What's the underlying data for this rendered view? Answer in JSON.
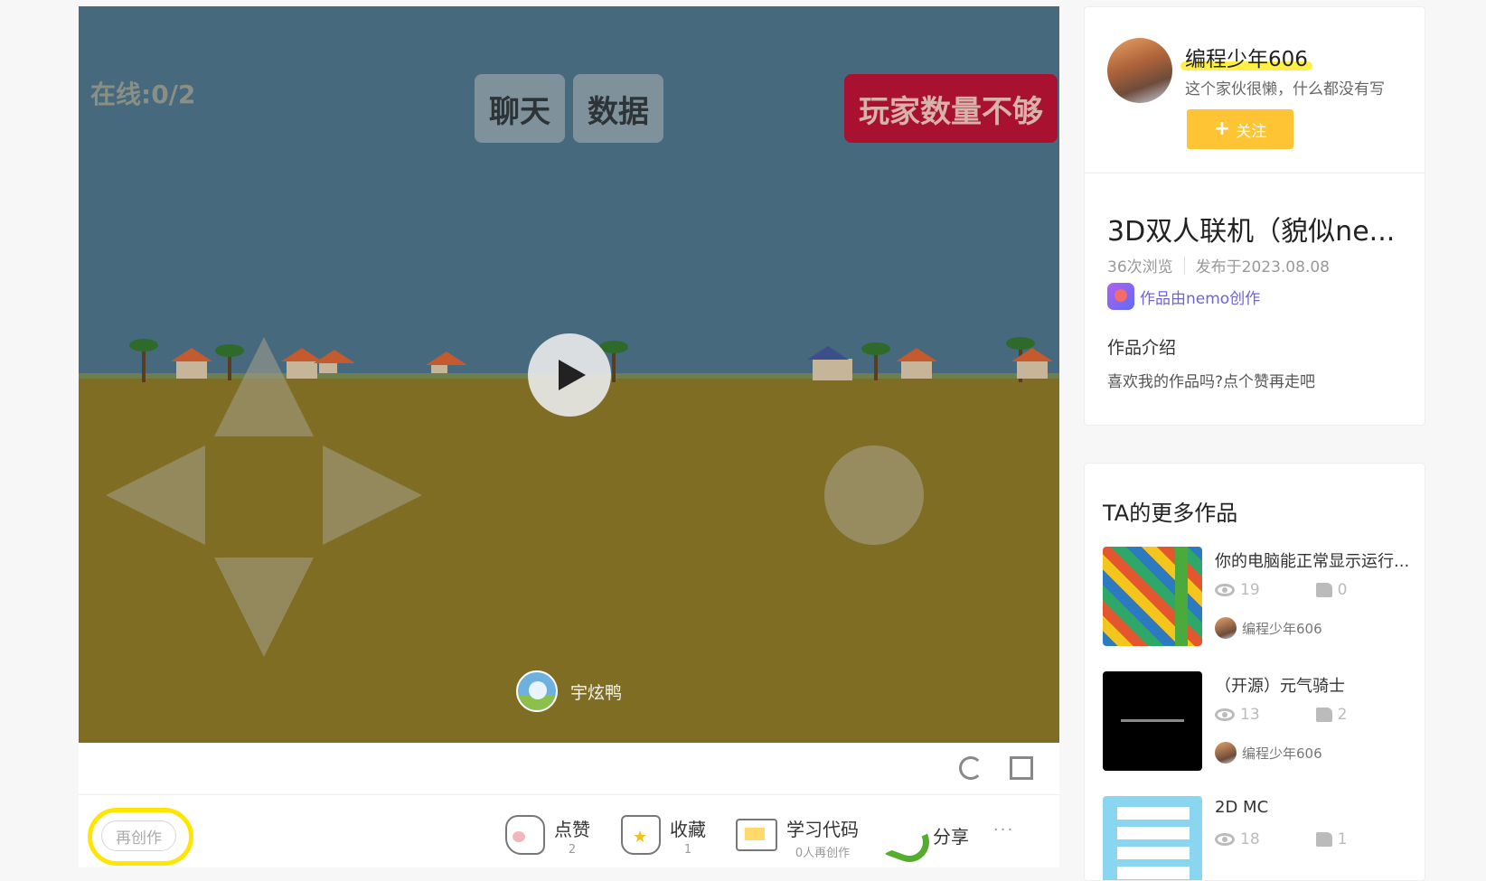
{
  "game": {
    "online_text": "在线:0/2",
    "chat_button": "聊天",
    "data_button": "数据",
    "warning_button": "玩家数量不够",
    "creator_name": "宇炫鸭"
  },
  "actions": {
    "remix_label": "再创作",
    "like_label": "点赞",
    "like_count": "2",
    "favorite_label": "收藏",
    "favorite_count": "1",
    "code_label": "学习代码",
    "code_sub": "0人再创作",
    "share_label": "分享",
    "more_label": "···"
  },
  "author": {
    "name": "编程少年606",
    "bio": "这个家伙很懒，什么都没有写",
    "follow_label": "关注",
    "follow_icon": "+"
  },
  "work": {
    "title": "3D双人联机（貌似ne...",
    "views": "36次浏览",
    "published": "发布于2023.08.08",
    "made_with": "作品由nemo创作",
    "intro_heading": "作品介绍",
    "intro_text": "喜欢我的作品吗?点个赞再走吧"
  },
  "more_works": {
    "heading": "TA的更多作品",
    "items": [
      {
        "title": "你的电脑能正常显示运行...",
        "views": "19",
        "likes": "0",
        "author": "编程少年606"
      },
      {
        "title": "（开源）元气骑士",
        "views": "13",
        "likes": "2",
        "author": "编程少年606"
      },
      {
        "title": "2D MC",
        "views": "18",
        "likes": "1",
        "author": ""
      }
    ]
  },
  "colors": {
    "accent_yellow": "#fec433",
    "warning_red": "#a8112f",
    "nemo_purple": "#6d63d8"
  }
}
